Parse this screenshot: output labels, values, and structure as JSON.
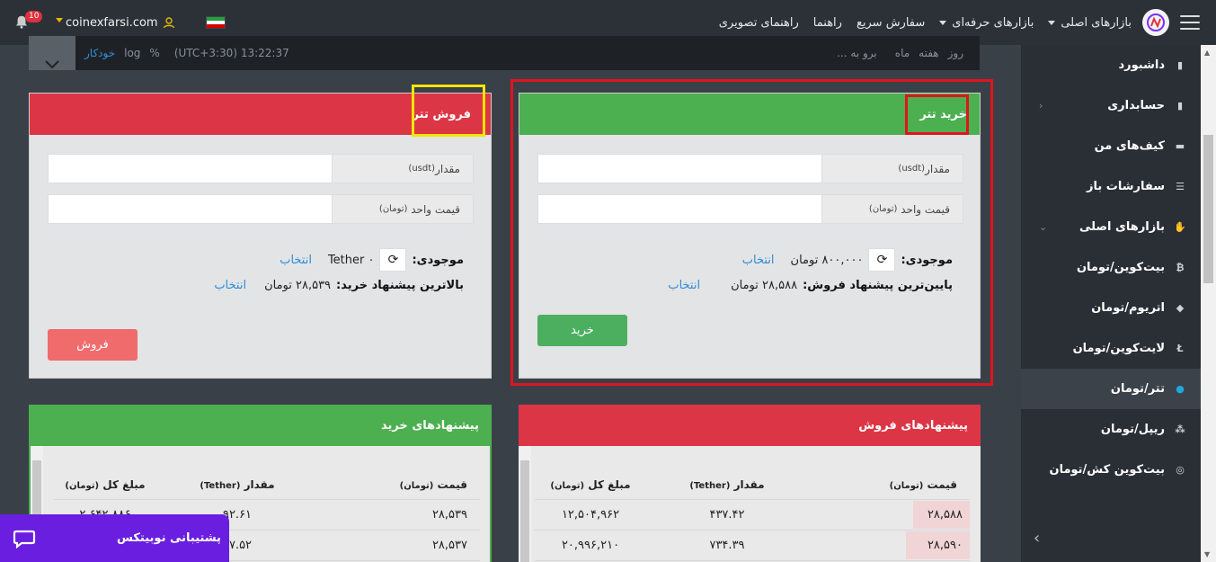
{
  "topbar": {
    "nav": [
      "بازارهای اصلی",
      "بازارهای حرفه‌ای",
      "سفارش سریع",
      "راهنما",
      "راهنمای تصویری"
    ],
    "site": "coinexfarsi.com",
    "notif_count": "10"
  },
  "chart_strip": {
    "items": [
      "روز",
      "هفته",
      "ماه",
      "برو به ...",
      "13:22:37 (UTC+3:30)",
      "%",
      "log",
      "خودکار"
    ]
  },
  "sidebar": {
    "items": [
      {
        "label": "داشبورد",
        "icon": "clipboard-icon"
      },
      {
        "label": "حسابداری",
        "icon": "report-icon"
      },
      {
        "label": "کیف‌های من",
        "icon": "wallet-icon"
      },
      {
        "label": "سفارشات باز",
        "icon": "list-icon"
      },
      {
        "label": "بازارهای اصلی",
        "icon": "handshake-icon"
      },
      {
        "label": "بیت‌کوین/تومان",
        "icon": "bitcoin-icon"
      },
      {
        "label": "اتریوم/تومان",
        "icon": "ethereum-icon"
      },
      {
        "label": "لایت‌کوین/تومان",
        "icon": "litecoin-icon"
      },
      {
        "label": "تتر/تومان",
        "icon": "tether-icon"
      },
      {
        "label": "ریپل/تومان",
        "icon": "ripple-icon"
      },
      {
        "label": "بیت‌کوین کش/تومان",
        "icon": "bitcoin-cash-icon"
      }
    ]
  },
  "buy_panel": {
    "title": "خرید تتر",
    "amount_label": "مقدار",
    "amount_unit": "(usdt)",
    "price_label": "قیمت واحد",
    "price_unit": "(تومان)",
    "balance_label": "موجودی:",
    "balance_value": "۸۰۰,۰۰۰ تومان",
    "select_link": "انتخاب",
    "best_label": "پایین‌ترین پیشنهاد فروش:",
    "best_value": "۲۸,۵۸۸ تومان",
    "button": "خرید"
  },
  "sell_panel": {
    "title": "فروش تتر",
    "amount_label": "مقدار",
    "amount_unit": "(usdt)",
    "price_label": "قیمت واحد",
    "price_unit": "(تومان)",
    "balance_label": "موجودی:",
    "balance_value": "Tether ۰",
    "select_link": "انتخاب",
    "best_label": "بالاترین پیشنهاد خرید:",
    "best_value": "۲۸,۵۳۹ تومان",
    "button": "فروش"
  },
  "sell_orders": {
    "title": "پیشنهادهای فروش",
    "headers": {
      "price": "قیمت",
      "price_unit": "(تومان)",
      "amount": "مقدار",
      "amount_unit": "(Tether)",
      "total": "مبلغ کل",
      "total_unit": "(تومان)"
    },
    "rows": [
      {
        "price": "۲۸,۵۸۸",
        "amount": "۴۳۷.۴۲",
        "total": "۱۲,۵۰۴,۹۶۲"
      },
      {
        "price": "۲۸,۵۹۰",
        "amount": "۷۳۴.۳۹",
        "total": "۲۰,۹۹۶,۲۱۰"
      }
    ]
  },
  "buy_orders": {
    "title": "پیشنهادهای خرید",
    "headers": {
      "price": "قیمت",
      "price_unit": "(تومان)",
      "amount": "مقدار",
      "amount_unit": "(Tether)",
      "total": "مبلغ کل",
      "total_unit": "(تومان)"
    },
    "rows": [
      {
        "price": "۲۸,۵۳۹",
        "amount": "۹۲.۶۱",
        "total": "۲,۶۴۲,۸۸۶"
      },
      {
        "price": "۲۸,۵۳۷",
        "amount": "۱۷.۵۲",
        "total": ""
      }
    ]
  },
  "support": {
    "label": "پشتیبانی نوبیتکس"
  },
  "colors": {
    "green": "#4caf50",
    "red": "#dc3545",
    "highlight_red": "#e0141e",
    "highlight_yellow": "#f5e600",
    "link": "#2f8dd6",
    "support": "#6a1ee0"
  }
}
